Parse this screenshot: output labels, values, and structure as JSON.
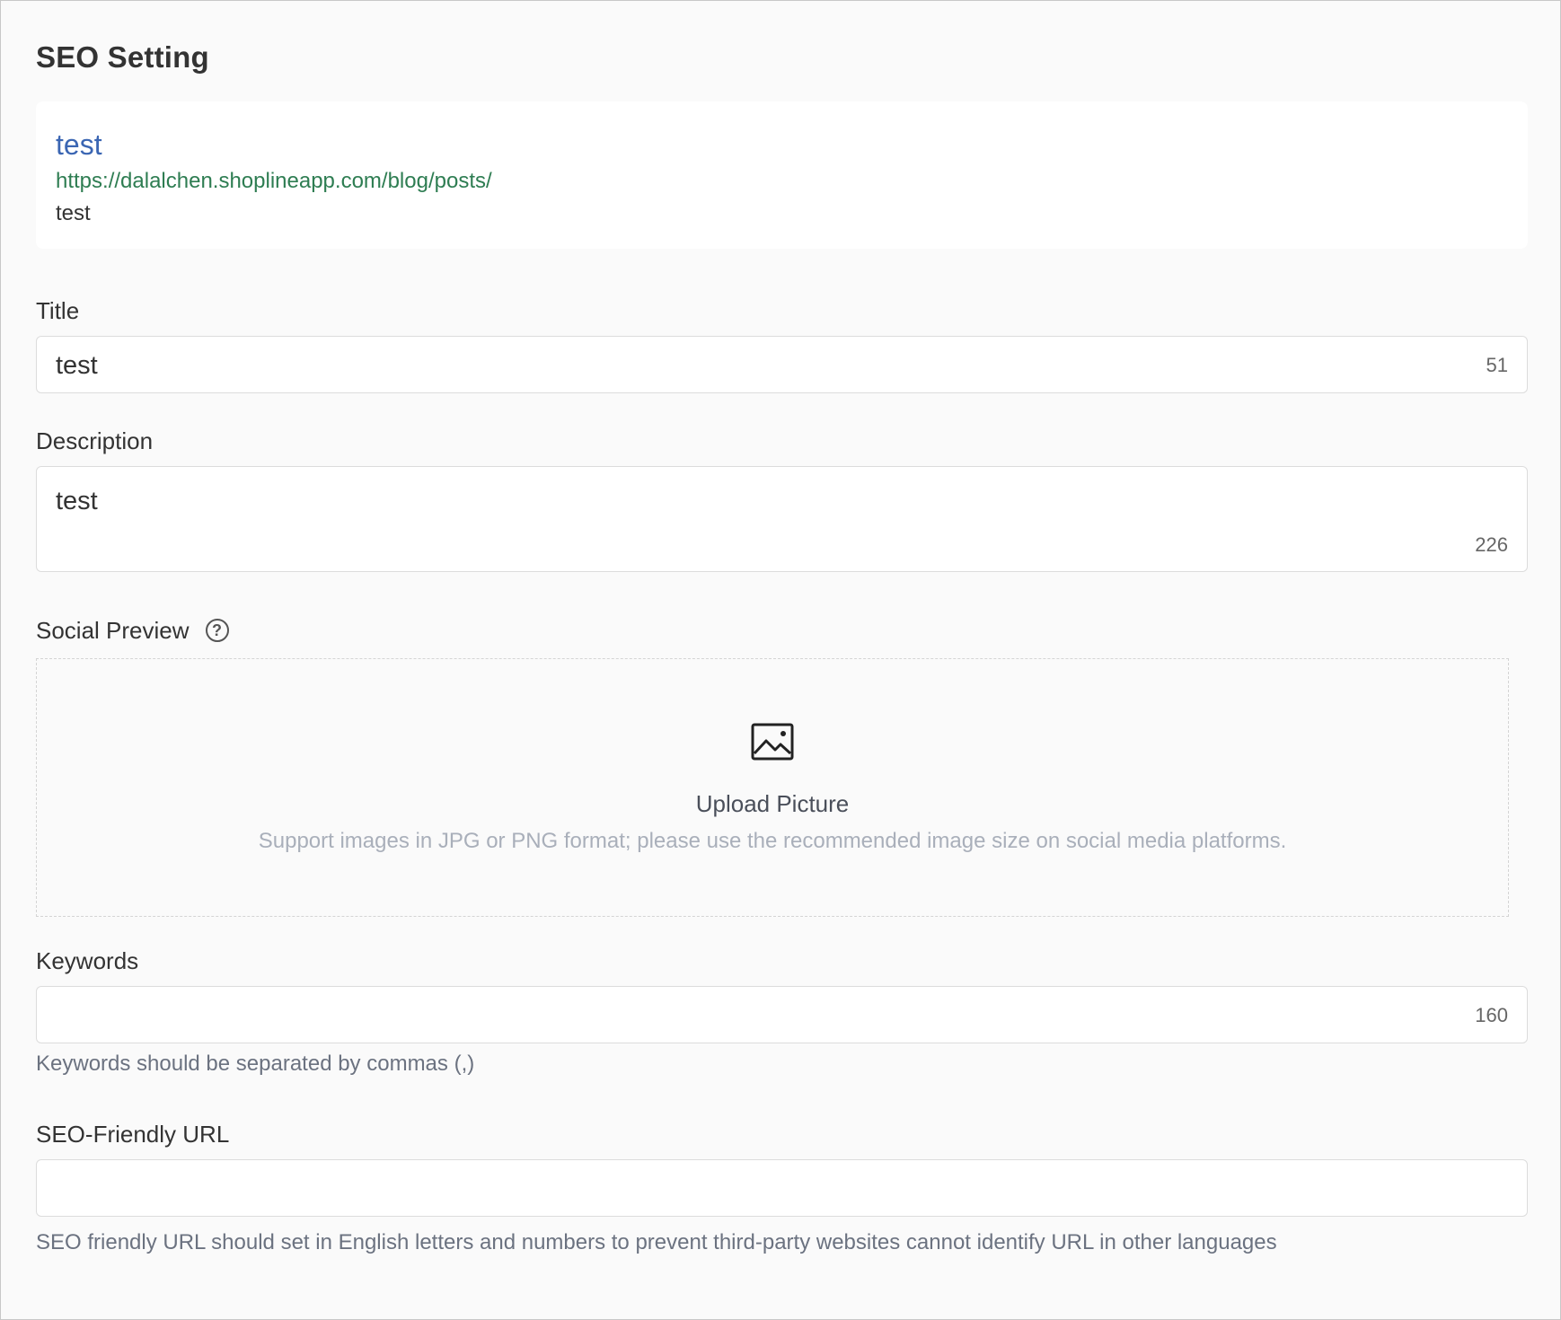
{
  "section": {
    "title": "SEO Setting"
  },
  "preview": {
    "title": "test",
    "url": "https://dalalchen.shoplineapp.com/blog/posts/",
    "description": "test"
  },
  "fields": {
    "title": {
      "label": "Title",
      "value": "test",
      "counter": "51"
    },
    "description": {
      "label": "Description",
      "value": "test",
      "counter": "226"
    },
    "social_preview": {
      "label": "Social Preview",
      "help_icon": "question-circle-icon",
      "help_glyph": "?",
      "upload_icon": "image-icon",
      "upload_title": "Upload Picture",
      "upload_hint": "Support images in JPG or PNG format; please use the recommended image size on social media platforms."
    },
    "keywords": {
      "label": "Keywords",
      "value": "",
      "counter": "160",
      "hint": "Keywords should be separated by commas (,)"
    },
    "seo_url": {
      "label": "SEO-Friendly URL",
      "value": "",
      "hint": "SEO friendly URL should set in English letters and numbers to prevent third-party websites cannot identify URL in other languages"
    }
  }
}
